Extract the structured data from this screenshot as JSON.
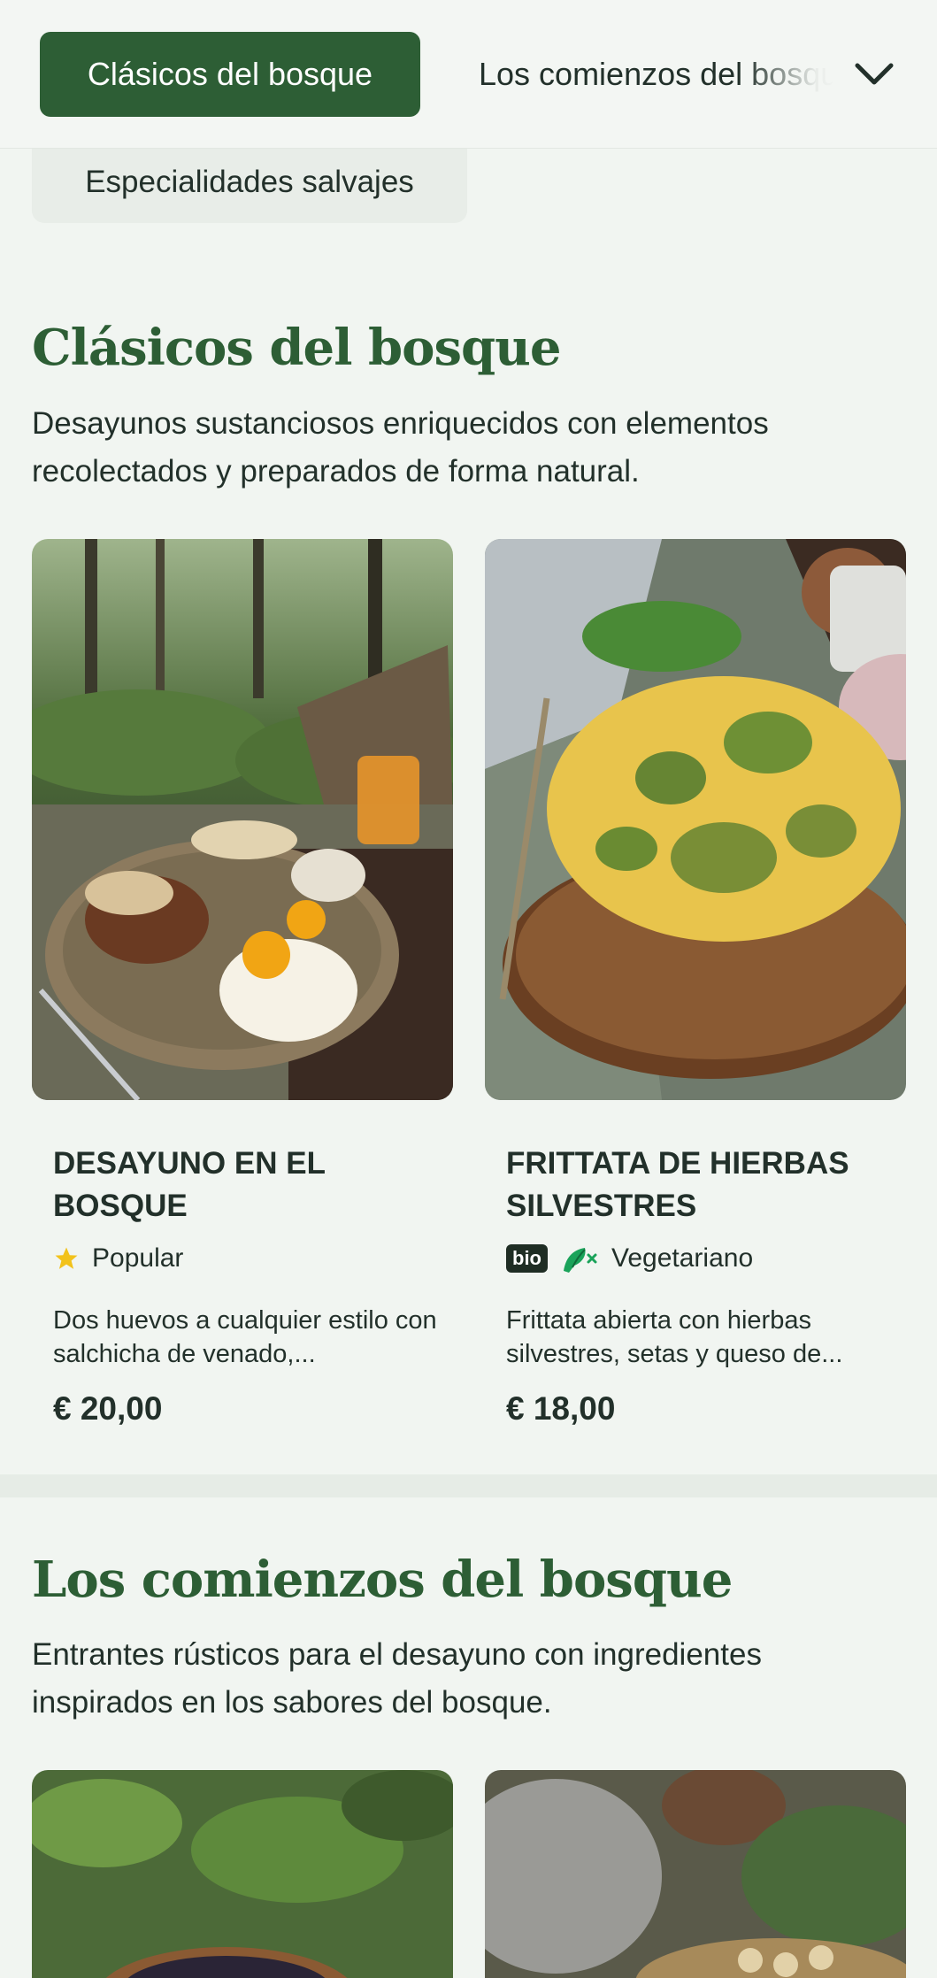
{
  "nav": {
    "active_tab": "Clásicos del bosque",
    "next_tab": "Los comienzos del bosque",
    "secondary_tab": "Especialidades salvajes",
    "expand_icon": "chevron-down-icon"
  },
  "sections": [
    {
      "title": "Clásicos del bosque",
      "description": "Desayunos sustanciosos enriquecidos con elementos recolectados y preparados de forma natural.",
      "items": [
        {
          "name": "DESAYUNO EN EL BOSQUE",
          "tag_icon": "star-icon",
          "tag": "Popular",
          "description": "Dos huevos a cualquier estilo con salchicha de venado,...",
          "price": "€ 20,00"
        },
        {
          "name": "FRITTATA DE HIERBAS SILVESTRES",
          "badge": "bio",
          "tag_icon": "vegetarian-icon",
          "tag": "Vegetariano",
          "description": "Frittata abierta con hierbas silvestres, setas y queso de...",
          "price": "€ 18,00"
        }
      ]
    },
    {
      "title": "Los comienzos del bosque",
      "description": "Entrantes rústicos para el desayuno con ingredientes inspirados en los sabores del bosque."
    }
  ],
  "colors": {
    "accent": "#2d5e35",
    "background": "#f1f5f1",
    "text": "#22302a",
    "star": "#f2c21b",
    "vegetarian": "#1aa35a"
  }
}
